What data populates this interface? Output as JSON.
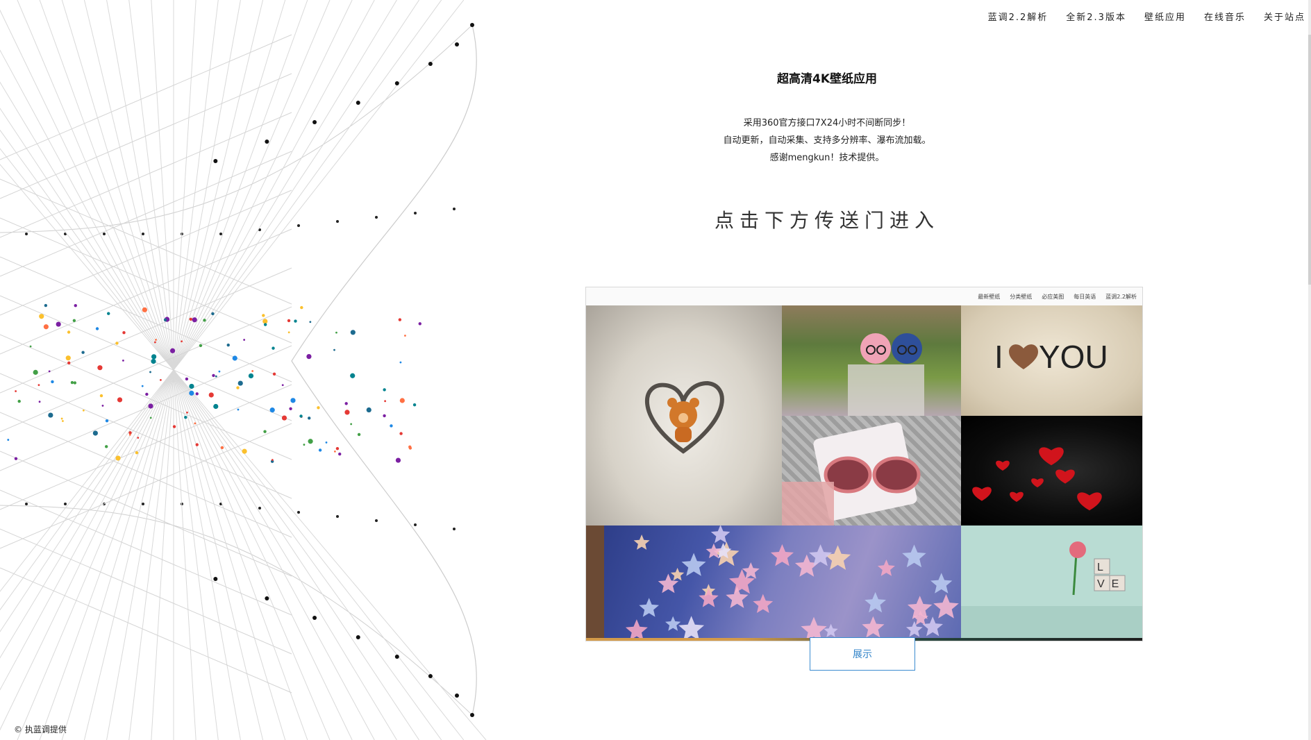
{
  "nav": {
    "items": [
      "蓝调2.2解析",
      "全新2.3版本",
      "壁纸应用",
      "在线音乐",
      "关于站点"
    ]
  },
  "hero": {
    "title": "超高清4K壁纸应用",
    "desc_lines": [
      "采用360官方接口7X24小时不间断同步！",
      "自动更新，自动采集、支持多分辨率、瀑布流加载。",
      "感谢mengkun！技术提供。"
    ],
    "cta": "点击下方传送门进入"
  },
  "preview": {
    "nav_items": [
      "最新壁纸",
      "分类壁纸",
      "必应美图",
      "每日英语",
      "蓝调2.2解析"
    ],
    "tile_i_love_you": "I",
    "tile_you": "YOU",
    "tile_love_top": "L",
    "tile_love_bottom": "VE"
  },
  "show_button": "展示",
  "footer": {
    "copyright_symbol": "©",
    "text": "执蓝调提供"
  },
  "colors": {
    "accent": "#2e82c8",
    "dot_palette": [
      "#1d6b8f",
      "#e53935",
      "#fbc02d",
      "#7b1fa2",
      "#43a047",
      "#ff7043",
      "#1e88e5",
      "#00838f"
    ]
  }
}
